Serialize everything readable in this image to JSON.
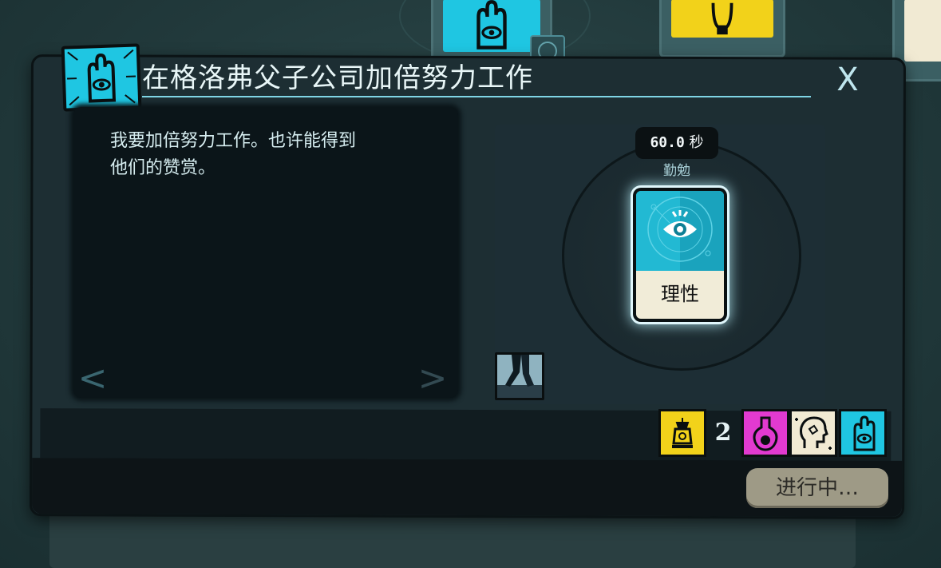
{
  "dialog": {
    "title": "在格洛弗父子公司加倍努力工作",
    "close_label": "X",
    "description_lines": [
      "我要加倍努力工作。也许能得到",
      "他们的赞赏。"
    ],
    "prev_label": "<",
    "next_label": ">",
    "status_label": "进行中…"
  },
  "slot": {
    "timer_value": "60.0",
    "timer_unit": "秒",
    "slot_label": "勤勉",
    "card_label": "理性"
  },
  "aspects": {
    "lantern_count": "2",
    "icons": [
      "lantern-icon",
      "flask-icon",
      "head-icon",
      "hand-eye-icon"
    ]
  },
  "colors": {
    "edge": "#1fc6e2",
    "lantern": "#f2d21a",
    "grail": "#e23ad0",
    "moth": "#f1ead3",
    "reason": "#22b9d3"
  }
}
